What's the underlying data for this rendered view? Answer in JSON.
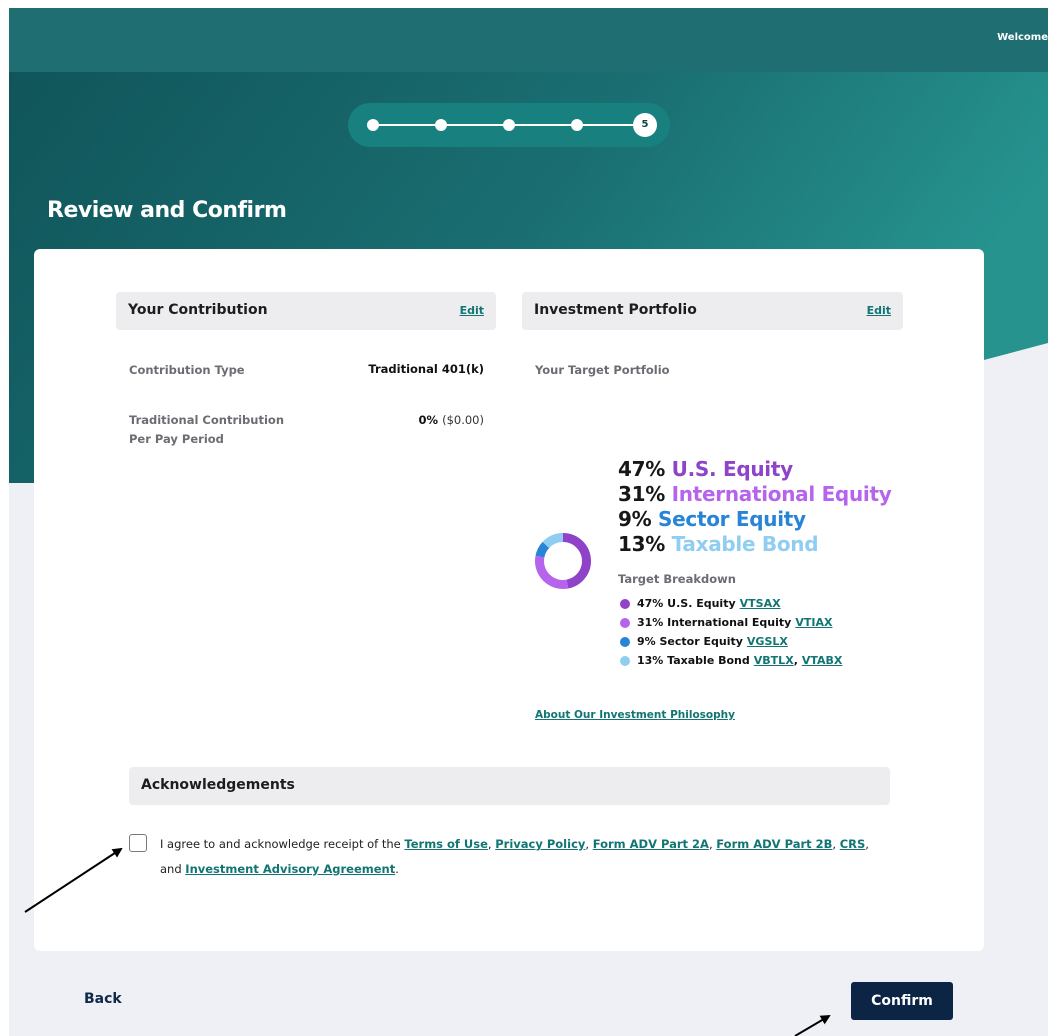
{
  "header": {
    "welcome_text": "Welcome"
  },
  "stepper": {
    "current_step": "5",
    "total_steps": 5
  },
  "page_title": "Review and Confirm",
  "contribution": {
    "title": "Your Contribution",
    "edit_label": "Edit",
    "type_label": "Contribution Type",
    "type_value": "Traditional 401(k)",
    "per_period_label_line1": "Traditional Contribution",
    "per_period_label_line2": "Per Pay Period",
    "per_period_pct": "0%",
    "per_period_amount": "($0.00)"
  },
  "portfolio": {
    "title": "Investment Portfolio",
    "edit_label": "Edit",
    "target_label": "Your Target Portfolio",
    "allocations": [
      {
        "pct": "47%",
        "name": "U.S. Equity",
        "color": "#8f43c8",
        "value": 47
      },
      {
        "pct": "31%",
        "name": "International Equity",
        "color": "#b764ec",
        "value": 31
      },
      {
        "pct": "9%",
        "name": "Sector Equity",
        "color": "#2784d6",
        "value": 9
      },
      {
        "pct": "13%",
        "name": "Taxable Bond",
        "color": "#8fcdf2",
        "value": 13
      }
    ],
    "breakdown_title": "Target Breakdown",
    "breakdown": [
      {
        "label": "47% U.S. Equity",
        "funds": "VTSAX"
      },
      {
        "label": "31% International Equity",
        "funds": "VTIAX"
      },
      {
        "label": "9% Sector Equity",
        "funds": "VGSLX"
      },
      {
        "label": "13% Taxable Bond",
        "fund1": "VBTLX",
        "sep": ",",
        "fund2": "VTABX"
      }
    ],
    "philosophy_link": "About Our Investment Philosophy"
  },
  "acknowledgements": {
    "title": "Acknowledgements",
    "text_intro": "I agree to and acknowledge receipt of the",
    "links": [
      "Terms of Use",
      "Privacy Policy",
      "Form ADV Part 2A",
      "Form ADV Part 2B",
      "CRS",
      "Investment Advisory Agreement"
    ],
    "text_and": "and",
    "comma": ",",
    "period": "."
  },
  "footer": {
    "back_label": "Back",
    "confirm_label": "Confirm"
  },
  "colors": {
    "header_teal": "#1f6f72",
    "stepper_bg": "#18807f",
    "link_teal": "#107573",
    "confirm_navy": "#0d2545",
    "page_bg": "#eef0f5"
  }
}
